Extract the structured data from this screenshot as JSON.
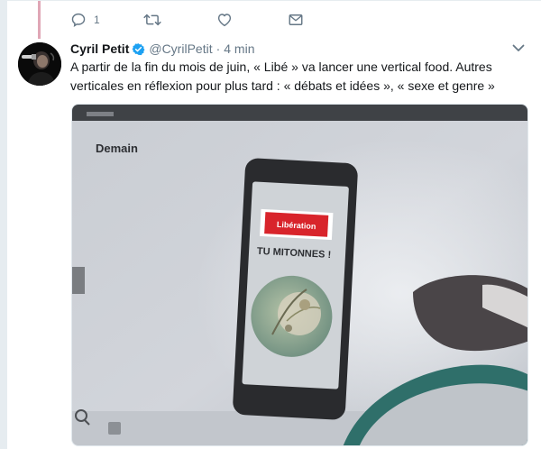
{
  "previous_tweet": {
    "actions": {
      "reply_count": "1",
      "reply_icon": "reply-icon",
      "retweet_icon": "retweet-icon",
      "like_icon": "heart-icon",
      "message_icon": "envelope-icon"
    }
  },
  "tweet": {
    "author_name": "Cyril Petit",
    "verified_icon": "verified-badge-icon",
    "screen_name": "@CyrilPetit",
    "separator": "·",
    "time": "4 min",
    "menu_icon": "chevron-down-icon",
    "text": "A partir de la fin du mois de juin, « Libé » va lancer une vertical food. Autres verticales en réflexion pour plus tard : « débats et idées », « sexe et genre »",
    "media": {
      "slide_title": "Demain",
      "phone_brand": "Libération",
      "phone_headline": "TU MITONNES !"
    }
  },
  "colors": {
    "thread_line": "#e0a7b6",
    "verified": "#1da1f2",
    "muted": "#657786",
    "text": "#14171a"
  }
}
